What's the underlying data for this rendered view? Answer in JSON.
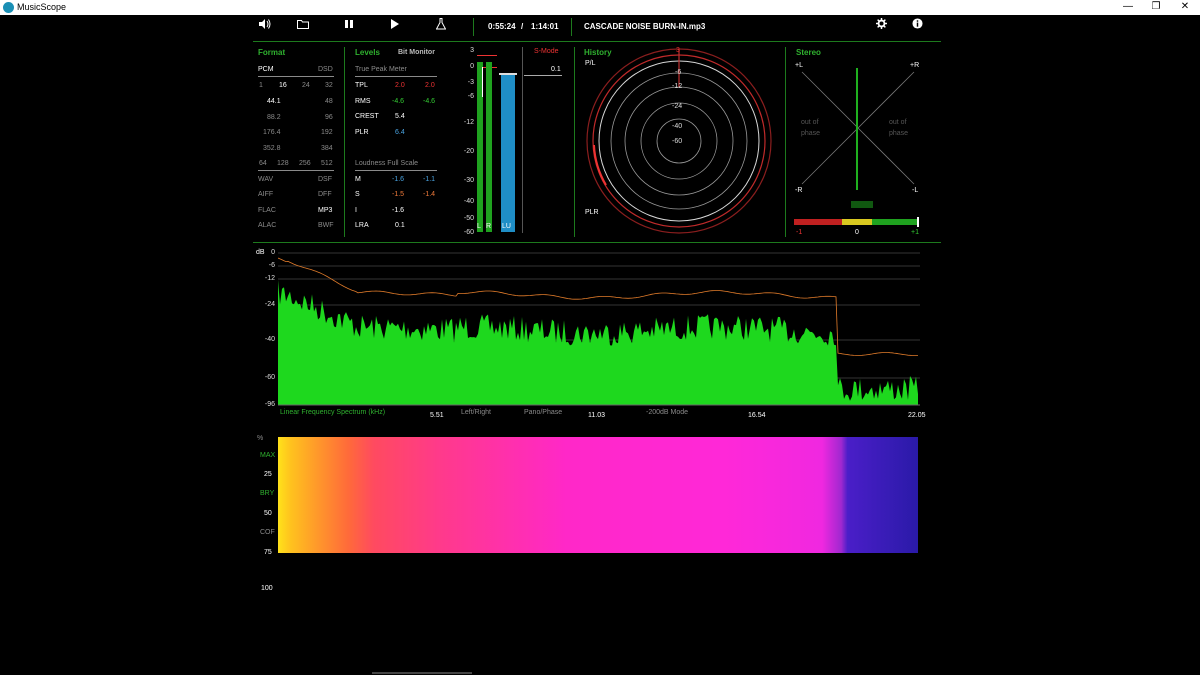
{
  "window": {
    "title": "MusicScope",
    "minimize": "—",
    "restore": "❐",
    "close": "✕"
  },
  "toolbar": {
    "icons": [
      "speaker-icon",
      "folder-icon",
      "pause-icon",
      "play-icon",
      "flask-icon",
      "gear-icon",
      "info-icon"
    ],
    "elapsed": "0:55:24",
    "separator": "/",
    "total": "1:14:01",
    "filename": "CASCADE NOISE BURN-IN.mp3"
  },
  "format": {
    "title": "Format",
    "pcm": "PCM",
    "dsd": "DSD",
    "bits": [
      "1",
      "16",
      "24",
      "32"
    ],
    "rates_left": [
      "44.1",
      "88.2",
      "176.4",
      "352.8"
    ],
    "rates_right": [
      "48",
      "96",
      "192",
      "384"
    ],
    "dsd_rates": [
      "64",
      "128",
      "256",
      "512"
    ],
    "files_left": [
      "WAV",
      "AIFF",
      "FLAC",
      "ALAC"
    ],
    "files_right": [
      "DSF",
      "DFF",
      "MP3",
      "BWF"
    ]
  },
  "levels": {
    "title": "Levels",
    "bit_monitor": "Bit Monitor",
    "true_peak_title": "True Peak Meter",
    "rows": [
      {
        "label": "TPL",
        "a": "2.0",
        "b": "2.0"
      },
      {
        "label": "RMS",
        "a": "-4.6",
        "b": "-4.6"
      },
      {
        "label": "CREST",
        "a": "5.4",
        "b": ""
      },
      {
        "label": "PLR",
        "a": "6.4",
        "b": ""
      }
    ],
    "loudness_title": "Loudness Full Scale",
    "loud_rows": [
      {
        "label": "M",
        "a": "-1.6",
        "b": "-1.1"
      },
      {
        "label": "S",
        "a": "-1.5",
        "b": "-1.4"
      },
      {
        "label": "I",
        "a": "-1.6",
        "b": ""
      },
      {
        "label": "LRA",
        "a": "0.1",
        "b": ""
      }
    ]
  },
  "meters": {
    "scale": [
      "3",
      "0",
      "-3",
      "-6",
      "-12",
      "-20",
      "-30",
      "-40",
      "-50",
      "-60"
    ],
    "labels": [
      "L",
      "R",
      "LU"
    ],
    "smode": "S-Mode",
    "smode_value": "0.1",
    "left_level_db": 2.0,
    "right_level_db": 2.0,
    "lu_level_db": -1.6
  },
  "history": {
    "title": "History",
    "pl": "P/L",
    "plr": "PLR",
    "rings": [
      "3",
      "-6",
      "-12",
      "-24",
      "-40",
      "-60"
    ]
  },
  "stereo": {
    "title": "Stereo",
    "plus_l": "+L",
    "plus_r": "+R",
    "minus_r": "-R",
    "minus_l": "-L",
    "out_of_phase": [
      "out of",
      "phase"
    ],
    "correlation_labels": [
      "-1",
      "0",
      "+1"
    ],
    "correlation_value": 1
  },
  "spectrum": {
    "db_label": "dB",
    "y_ticks": [
      "0",
      "-6",
      "-12",
      "-24",
      "-40",
      "-60",
      "-96"
    ],
    "title": "Linear Frequency Spectrum (kHz)",
    "x_ticks": [
      "5.51",
      "11.03",
      "16.54",
      "22.05"
    ],
    "modes": [
      "Left/Right",
      "Pano/Phase",
      "-200dB Mode"
    ]
  },
  "spectrogram": {
    "y_labels": [
      "%",
      "MAX",
      "25",
      "BRY",
      "50",
      "COF",
      "75",
      "100"
    ]
  },
  "colors": {
    "accent_green": "#2fb12f",
    "spectrum_fill": "#1ed81e",
    "peak_line": "#e07b2a",
    "red": "#e33333",
    "lu_blue": "#1f8ec6"
  }
}
